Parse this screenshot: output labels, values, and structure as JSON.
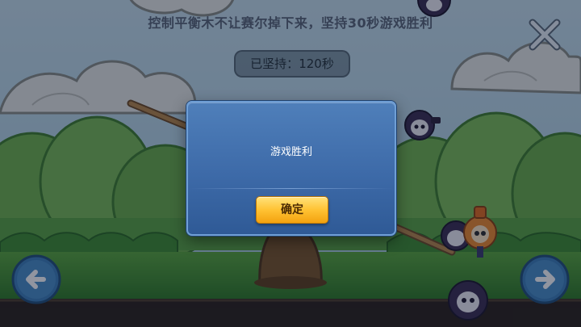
{
  "hud": {
    "instruction": "控制平衡木不让赛尔掉下来，坚持30秒游戏胜利",
    "timer_label": "已坚持：",
    "timer_value": "120秒",
    "close_icon": "close-x-icon",
    "left_arrow_icon": "arrow-left-icon",
    "right_arrow_icon": "arrow-right-icon"
  },
  "dialog": {
    "message": "游戏胜利",
    "confirm_label": "确定"
  },
  "colors": {
    "sky": "#b9d6e6",
    "grass": "#4f9a33",
    "dialog_bg": "#3d6aa8",
    "button": "#ffc233"
  }
}
